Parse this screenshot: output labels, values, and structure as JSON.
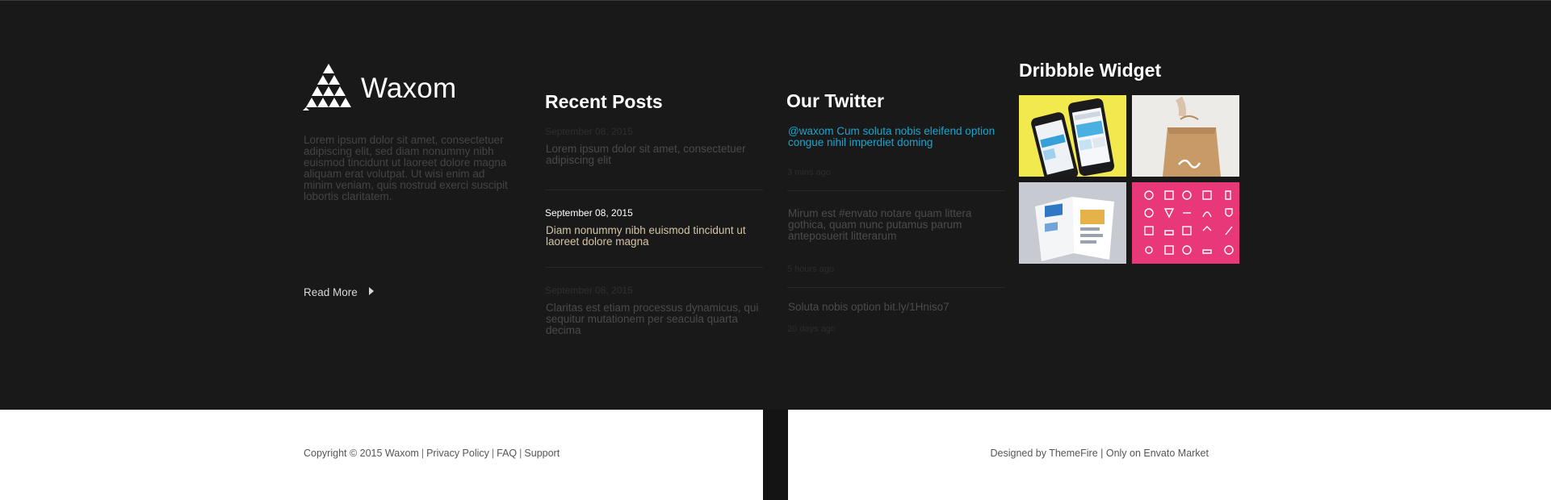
{
  "brand": {
    "name": "Waxom",
    "about": "Lorem ipsum dolor sit amet, consectetuer adipiscing elit, sed diam nonummy nibh euismod tincidunt ut laoreet dolore magna aliquam erat volutpat. Ut wisi enim ad minim veniam, quis nostrud exerci suscipit lobortis claritatem.",
    "read_more": "Read More"
  },
  "recent_posts": {
    "title": "Recent Posts",
    "items": [
      {
        "date": "September 08, 2015",
        "text": "Lorem ipsum dolor sit amet, consectetuer adipiscing elit"
      },
      {
        "date": "September 08, 2015",
        "text": "Diam nonummy nibh euismod tincidunt ut laoreet dolore magna"
      },
      {
        "date": "September 08, 2015",
        "text": "Claritas est etiam processus dynamicus, qui sequitur mutationem per seacula quarta decima"
      }
    ]
  },
  "twitter": {
    "title": "Our Twitter",
    "items": [
      {
        "text": "@waxom Cum soluta nobis eleifend option congue nihil imperdiet doming",
        "time": "3 mins ago"
      },
      {
        "text": "Mirum est #envato notare quam littera gothica, quam nunc putamus parum anteposuerit litterarum",
        "time": "5 hours ago"
      },
      {
        "text": "Soluta nobis option bit.ly/1Hniso7",
        "time": "20 days ago"
      }
    ]
  },
  "dribbble": {
    "title": "Dribbble Widget",
    "shots": [
      {
        "name": "phone-app-shot",
        "bg": "#f2e94e"
      },
      {
        "name": "paper-bag-shot",
        "bg": "#e9e9e7"
      },
      {
        "name": "brochure-shot",
        "bg": "#c9ccd1"
      },
      {
        "name": "icon-set-shot",
        "bg": "#e8387a"
      }
    ]
  },
  "bottom": {
    "copyright": "Copyright © 2015 Waxom",
    "privacy": "Privacy Policy",
    "faq": "FAQ",
    "support": "Support",
    "credit": "Designed by ThemeFire | Only on Envato Market"
  }
}
